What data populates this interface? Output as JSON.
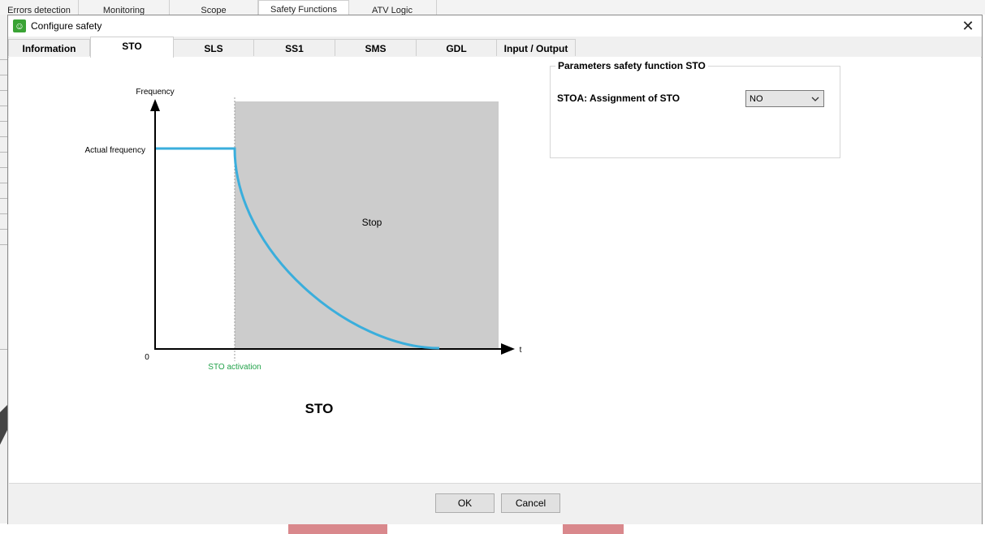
{
  "background": {
    "tabs": [
      "Errors detection",
      "Monitoring",
      "Scope",
      "Safety Functions",
      "ATV Logic"
    ]
  },
  "dialog": {
    "title": "Configure safety",
    "tabs": [
      "Information",
      "STO",
      "SLS",
      "SS1",
      "SMS",
      "GDL",
      "Input / Output"
    ],
    "active_tab": "STO"
  },
  "diagram": {
    "y_axis_label": "Frequency",
    "actual_frequency_label": "Actual frequency",
    "origin_label": "0",
    "x_axis_label": "t",
    "activation_label": "STO activation",
    "stop_label": "Stop",
    "caption": "STO",
    "colors": {
      "curve": "#3aaedc",
      "stop_area": "#cccccc",
      "activation": "#22a24a"
    }
  },
  "parameters": {
    "group_title": "Parameters safety function STO",
    "stoa_label": "STOA: Assignment of STO",
    "stoa_value": "NO"
  },
  "buttons": {
    "ok": "OK",
    "cancel": "Cancel"
  },
  "icons": {
    "app": "safety-config-icon",
    "close": "close-icon",
    "dropdown": "chevron-down-icon"
  }
}
